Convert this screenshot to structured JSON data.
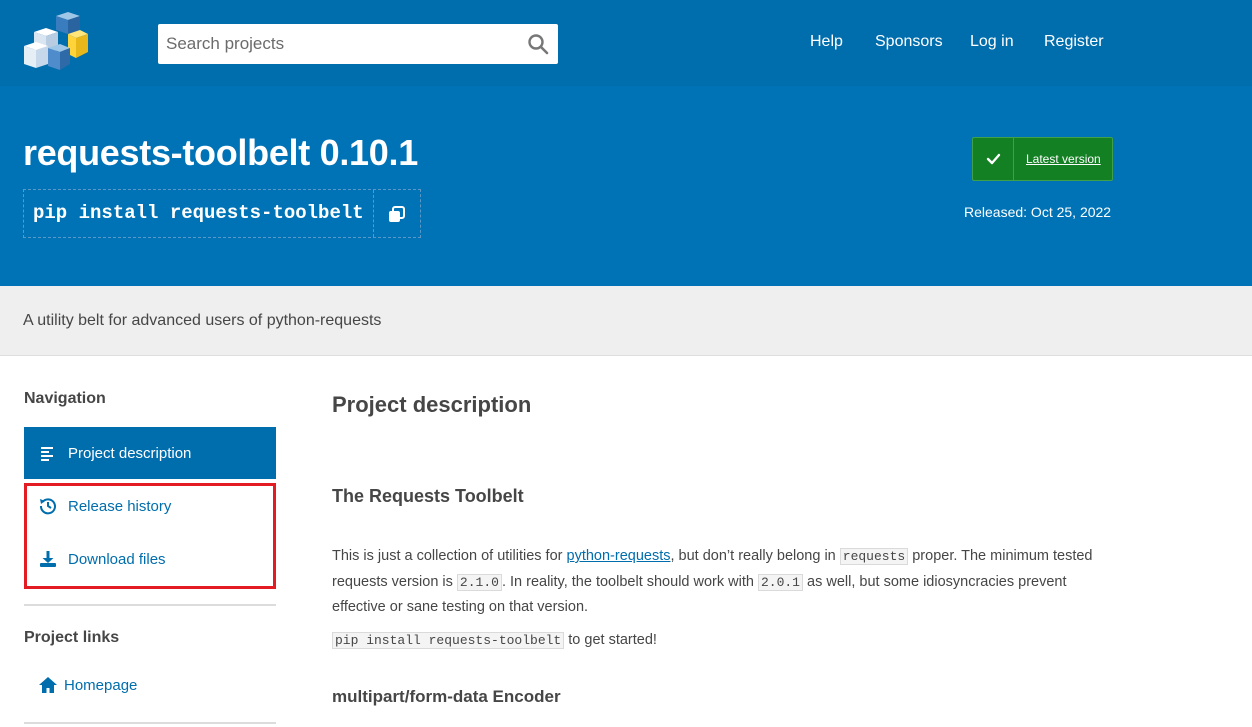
{
  "header": {
    "search_placeholder": "Search projects",
    "nav": [
      "Help",
      "Sponsors",
      "Log in",
      "Register"
    ]
  },
  "package": {
    "title": "requests-toolbelt 0.10.1",
    "pip_command": "pip install requests-toolbelt",
    "latest_label": "Latest version",
    "released": "Released: Oct 25, 2022",
    "summary": "A utility belt for advanced users of python-requests"
  },
  "sidebar": {
    "navigation_heading": "Navigation",
    "items": [
      {
        "label": "Project description",
        "icon": "align-left-icon",
        "active": true
      },
      {
        "label": "Release history",
        "icon": "history-icon"
      },
      {
        "label": "Download files",
        "icon": "download-icon"
      }
    ],
    "links_heading": "Project links",
    "links": [
      {
        "label": "Homepage",
        "icon": "home-icon"
      }
    ]
  },
  "main": {
    "heading": "Project description",
    "subheading": "The Requests Toolbelt",
    "p1": {
      "a": "This is just a collection of utilities for ",
      "link": "python-requests",
      "b": ", but don’t really belong in ",
      "code1": "requests",
      "c": " proper. The minimum tested requests version is ",
      "code2": "2.1.0",
      "d": ". In reality, the toolbelt should work with ",
      "code3": "2.0.1",
      "e": " as well, but some idiosyncracies prevent effective or sane testing on that version."
    },
    "p2": {
      "code": "pip install requests-toolbelt",
      "text": " to get started!"
    },
    "subheading2": "multipart/form-data Encoder"
  },
  "colors": {
    "header_bg": "#006dad",
    "banner_bg": "#0073b7",
    "latest_bg": "#148024",
    "highlight": "#e31b23"
  }
}
